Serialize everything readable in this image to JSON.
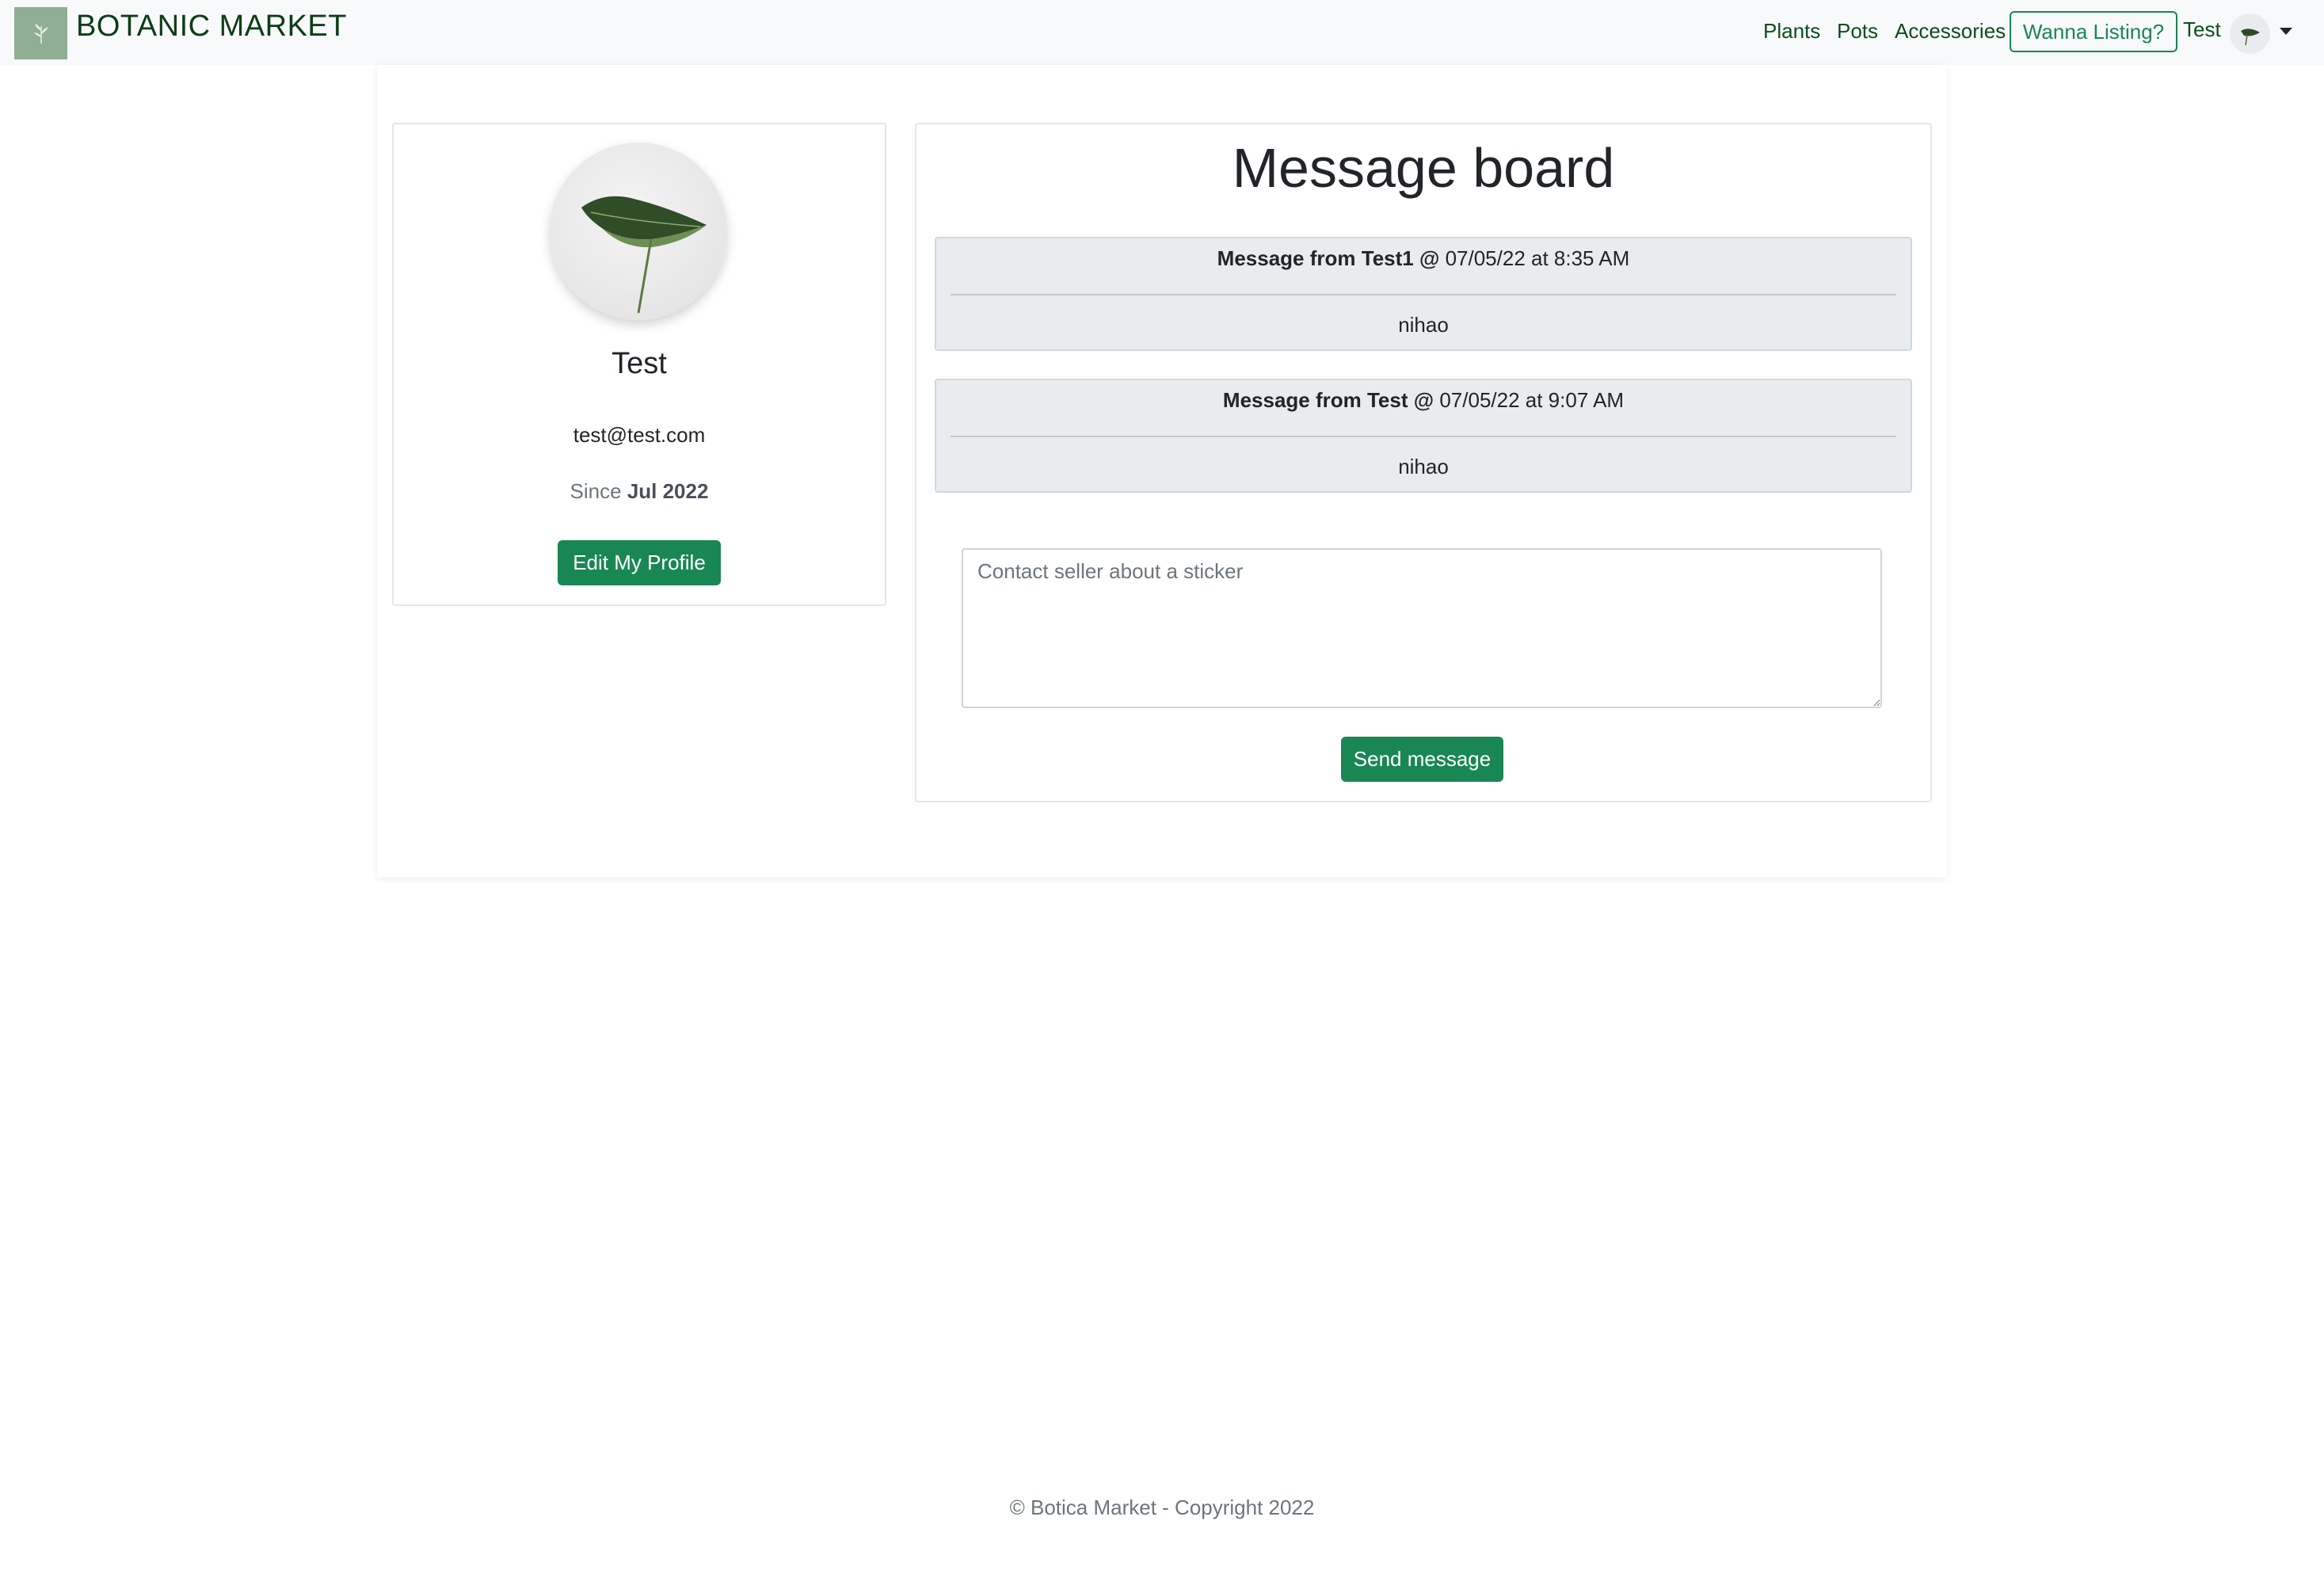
{
  "navbar": {
    "brand": "BOTANIC MARKET",
    "links": [
      "Plants",
      "Pots",
      "Accessories"
    ],
    "cta_label": "Wanna Listing?",
    "user_name": "Test"
  },
  "profile": {
    "name": "Test",
    "email": "test@test.com",
    "since_prefix": "Since",
    "since_value": "Jul 2022",
    "edit_button": "Edit My Profile"
  },
  "board": {
    "title": "Message board",
    "messages": [
      {
        "prefix": "Message from",
        "author": "Test1",
        "at": "@",
        "time": "07/05/22 at 8:35 AM",
        "body": "nihao"
      },
      {
        "prefix": "Message from",
        "author": "Test",
        "at": "@",
        "time": "07/05/22 at 9:07 AM",
        "body": "nihao"
      }
    ],
    "input_placeholder": "Contact seller about a sticker",
    "send_button": "Send message"
  },
  "footer": "© Botica Market - Copyright 2022",
  "colors": {
    "brand_green": "#198754",
    "nav_bg": "#f8f9fa",
    "message_bg": "#e9ecef"
  }
}
